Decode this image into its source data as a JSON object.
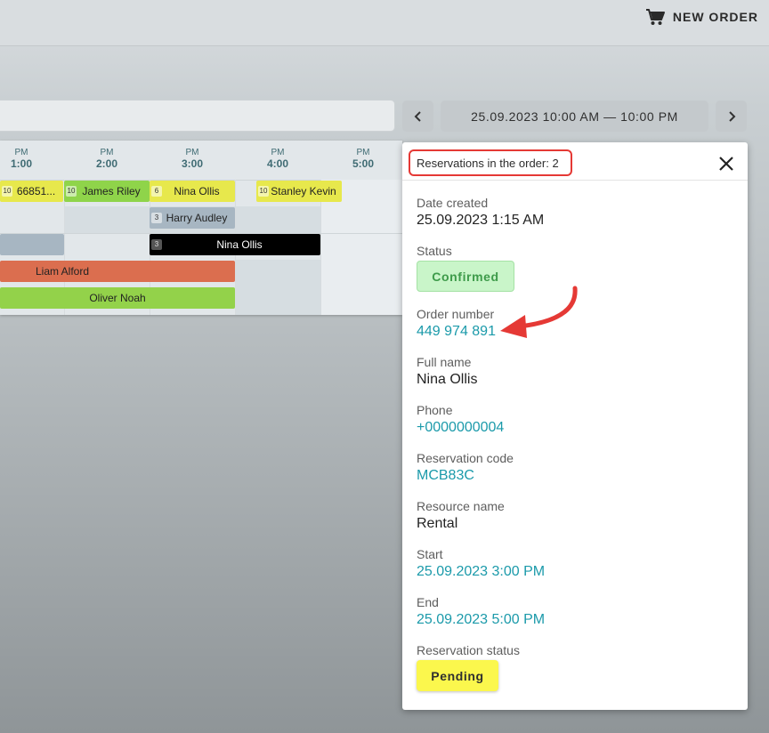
{
  "header": {
    "new_order_label": "NEW ORDER",
    "cart_icon": "cart-icon"
  },
  "toolbar": {
    "date_range": "25.09.2023 10:00 AM — 10:00 PM",
    "prev_icon": "chevron-left-icon",
    "next_icon": "chevron-right-icon"
  },
  "timeline": {
    "ticks": [
      {
        "ampm": "PM",
        "hour": "1:00"
      },
      {
        "ampm": "PM",
        "hour": "2:00"
      },
      {
        "ampm": "PM",
        "hour": "3:00"
      },
      {
        "ampm": "PM",
        "hour": "4:00"
      },
      {
        "ampm": "PM",
        "hour": "5:00"
      }
    ],
    "reservations": [
      {
        "count": "10",
        "name": "66851...",
        "color": "#e7e84c"
      },
      {
        "count": "10",
        "name": "James Riley",
        "color": "#8fd44a"
      },
      {
        "count": "6",
        "name": "Nina Ollis",
        "color": "#e7e84c"
      },
      {
        "count": "10",
        "name": "Stanley Kevin",
        "color": "#e7e84c"
      },
      {
        "count": "3",
        "name": "Harry Audley",
        "color": "#a7b6c2"
      },
      {
        "count": "",
        "name": "",
        "color": "#a7b6c2"
      },
      {
        "count": "3",
        "name": "Nina Ollis",
        "color": "#000000"
      },
      {
        "count": "",
        "name": "Liam Alford",
        "color": "#db6e4f"
      },
      {
        "count": "",
        "name": "Oliver Noah",
        "color": "#93d24a"
      }
    ]
  },
  "panel": {
    "title": "Reservations in the order: 2",
    "close_icon": "close-icon",
    "fields": {
      "date_created": {
        "label": "Date created",
        "value": "25.09.2023 1:15 AM"
      },
      "status": {
        "label": "Status",
        "value": "Confirmed"
      },
      "order_number": {
        "label": "Order number",
        "value": "449 974 891"
      },
      "full_name": {
        "label": "Full name",
        "value": "Nina Ollis"
      },
      "phone": {
        "label": "Phone",
        "value": "+0000000004"
      },
      "reservation_code": {
        "label": "Reservation code",
        "value": "MCB83C"
      },
      "resource_name": {
        "label": "Resource name",
        "value": "Rental"
      },
      "start": {
        "label": "Start",
        "value": "25.09.2023 3:00 PM"
      },
      "end": {
        "label": "End",
        "value": "25.09.2023 5:00 PM"
      },
      "reservation_status": {
        "label": "Reservation status",
        "value": "Pending"
      }
    }
  },
  "colors": {
    "link": "#1b9aaa",
    "annotation_red": "#e53935",
    "confirmed_bg": "#c9f5c9",
    "pending_bg": "#fbf74d"
  }
}
